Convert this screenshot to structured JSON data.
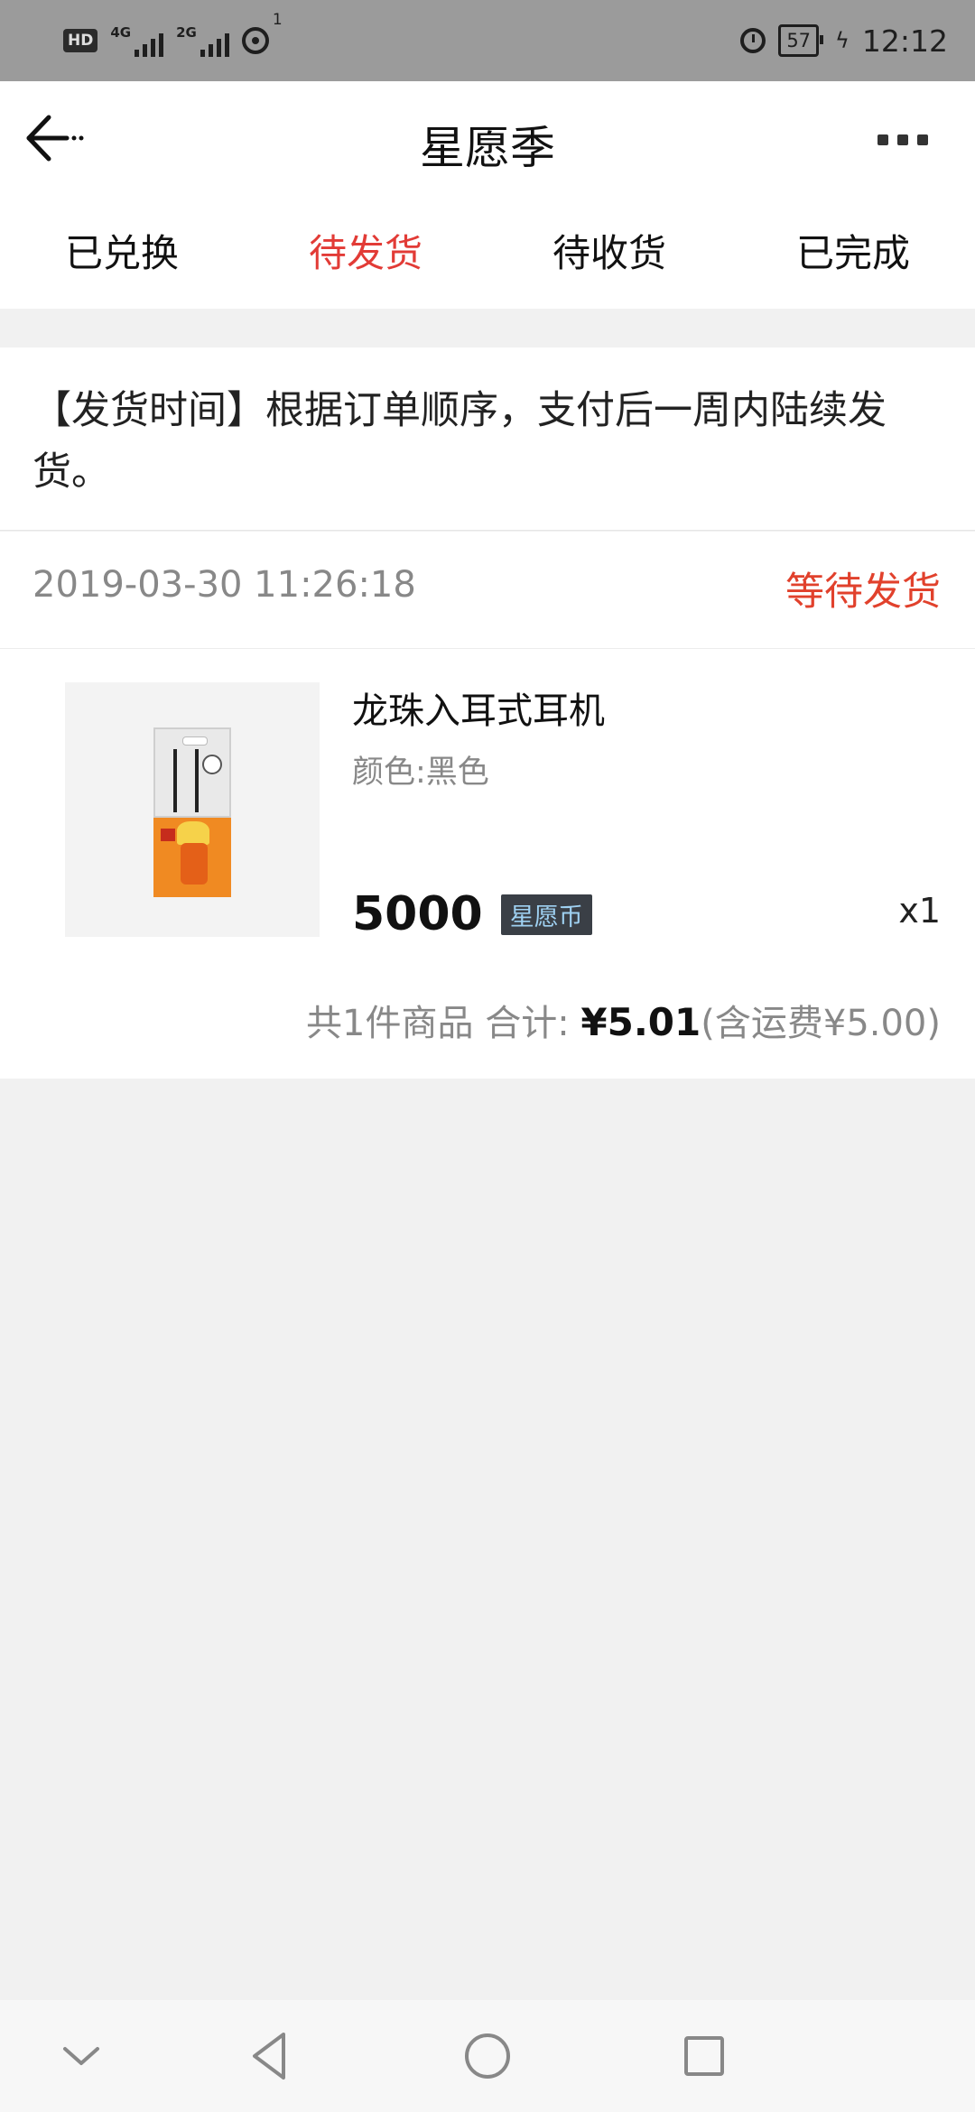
{
  "status_bar": {
    "hd_label": "HD",
    "network_1": "4G",
    "network_2": "2G",
    "hotspot_count": "1",
    "battery": "57",
    "time": "12:12"
  },
  "header": {
    "title": "星愿季",
    "back_icon": "back-arrow-icon",
    "more_icon": "more-dots-icon"
  },
  "tabs": [
    {
      "label": "已兑换",
      "active": false
    },
    {
      "label": "待发货",
      "active": true
    },
    {
      "label": "待收货",
      "active": false
    },
    {
      "label": "已完成",
      "active": false
    }
  ],
  "notice": {
    "text": "【发货时间】根据订单顺序，支付后一周内陆续发货。"
  },
  "order": {
    "time": "2019-03-30 11:26:18",
    "status": "等待发货",
    "product_name": "龙珠入耳式耳机",
    "product_spec": "颜色:黑色",
    "price": "5000",
    "currency_tag": "星愿币",
    "quantity": "x1",
    "summary_count": "共1件商品 合计: ",
    "summary_total": "¥5.01",
    "summary_shipping": "(含运费¥5.00)"
  },
  "colors": {
    "accent_red": "#e23b36",
    "status_orange": "#e1412c",
    "coin_tag_bg": "#3a3f46"
  }
}
